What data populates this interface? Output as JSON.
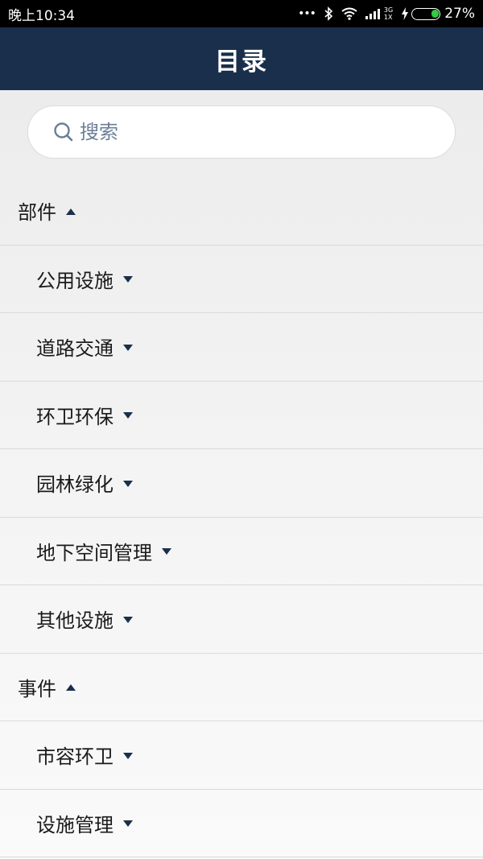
{
  "status_bar": {
    "time": "晚上10:34",
    "dots": "•••",
    "network_top": "3G",
    "network_bottom": "1X",
    "battery_percent": "27%",
    "battery_level": 0.27,
    "icons": [
      "bluetooth-icon",
      "wifi-icon",
      "signal-icon",
      "charging-icon",
      "battery-icon"
    ]
  },
  "nav": {
    "title": "目录"
  },
  "search": {
    "placeholder": "搜索",
    "value": "",
    "icon": "search-icon"
  },
  "colors": {
    "nav_background": "#1a2f4b",
    "caret": "#1a2f4b",
    "search_placeholder": "#6b7f96",
    "battery_fill": "#2ecc40"
  },
  "sections": {
    "components": {
      "label": "部件",
      "expanded": true,
      "items": [
        {
          "label": "公用设施"
        },
        {
          "label": "道路交通"
        },
        {
          "label": "环卫环保"
        },
        {
          "label": "园林绿化"
        },
        {
          "label": "地下空间管理"
        },
        {
          "label": "其他设施"
        }
      ]
    },
    "events": {
      "label": "事件",
      "expanded": true,
      "items": [
        {
          "label": "市容环卫"
        },
        {
          "label": "设施管理"
        }
      ]
    }
  }
}
